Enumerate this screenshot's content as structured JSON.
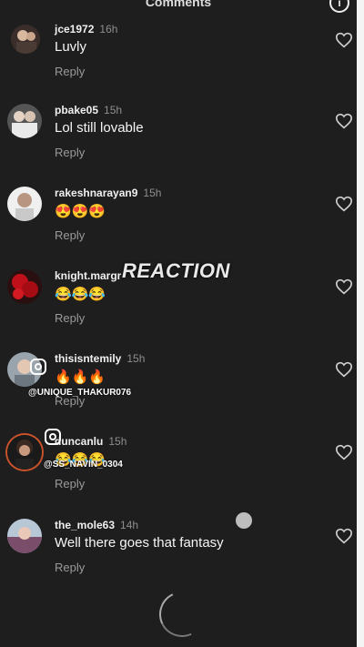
{
  "header": {
    "title": "Comments",
    "info_glyph": "i"
  },
  "comments": [
    {
      "user": "jce1972",
      "time": "16h",
      "text": "Luvly",
      "reply": "Reply"
    },
    {
      "user": "pbake05",
      "time": "15h",
      "text": "Lol still lovable",
      "reply": "Reply"
    },
    {
      "user": "rakeshnarayan9",
      "time": "15h",
      "text": "😍😍😍",
      "reply": "Reply"
    },
    {
      "user": "knight.margr",
      "time": "",
      "text": "😂😂😂",
      "reply": "Reply"
    },
    {
      "user": "thisisntemily",
      "time": "15h",
      "text": "🔥🔥🔥",
      "reply": "Reply"
    },
    {
      "user": "duncanlu",
      "time": "15h",
      "text": "😂😂😂",
      "reply": "Reply"
    },
    {
      "user": "the_mole63",
      "time": "14h",
      "text": "Well there goes that fantasy",
      "reply": "Reply"
    }
  ],
  "overlay": {
    "reaction": "REACTION",
    "watermark_1": "@UNIQUE_THAKUR076",
    "watermark_2": "@SS_NAVIN_0304"
  },
  "icons": {
    "like": "heart-outline-icon",
    "info": "info-icon",
    "instagram": "instagram-icon"
  }
}
